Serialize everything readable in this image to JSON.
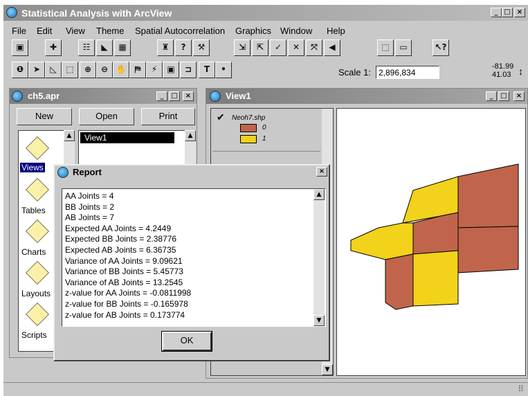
{
  "window": {
    "title": "Statistical Analysis with ArcView"
  },
  "menu": [
    "File",
    "Edit",
    "View",
    "Theme",
    "Spatial Autocorrelation",
    "Graphics",
    "Window",
    "Help"
  ],
  "toolbar1_icons": [
    "save-icon",
    "add-theme-icon",
    "theme-properties-icon",
    "edit-legend-icon",
    "open-table-icon",
    "find-icon",
    "locate-icon",
    "query-builder-icon",
    "zoom-full-icon",
    "zoom-active-icon",
    "zoom-selected-icon",
    "zoom-in-fixed-icon",
    "zoom-out-fixed-icon",
    "zoom-previous-icon",
    "select-graphics-icon",
    "clear-selected-icon",
    "help-icon"
  ],
  "toolbar2_icons": [
    "identify-icon",
    "pointer-icon",
    "vertex-edit-icon",
    "select-feature-icon",
    "zoom-in-icon",
    "zoom-out-icon",
    "pan-icon",
    "measure-icon",
    "hotlink-icon",
    "area-of-interest-icon",
    "label-icon",
    "text-icon",
    "draw-point-icon"
  ],
  "toolbar2_glyphs": [
    "❶",
    "➤",
    "◺",
    "⬚",
    "⊕",
    "⊖",
    "✋",
    "⛿",
    "⚡",
    "▣",
    "⊐",
    "T",
    "•"
  ],
  "scale": {
    "label": "Scale 1:",
    "value": "2,896,834"
  },
  "coords": {
    "x": "-81.99",
    "y": "41.03"
  },
  "project": {
    "title": "ch5.apr",
    "buttons": {
      "new": "New",
      "open": "Open",
      "print": "Print"
    },
    "icons": [
      {
        "label": "Views",
        "icon": "views-icon"
      },
      {
        "label": "Tables",
        "icon": "tables-icon"
      },
      {
        "label": "Charts",
        "icon": "charts-icon"
      },
      {
        "label": "Layouts",
        "icon": "layouts-icon"
      },
      {
        "label": "Scripts",
        "icon": "scripts-icon"
      }
    ],
    "list_selected": "View1"
  },
  "view": {
    "title": "View1",
    "theme": "Neoh7.shp",
    "legend": [
      {
        "label": "0",
        "color": "#c0654b"
      },
      {
        "label": "1",
        "color": "#f2d21a"
      }
    ]
  },
  "report": {
    "title": "Report",
    "lines": [
      "AA Joints = 4",
      "BB Joints = 2",
      "AB Joints = 7",
      "Expected AA Joints = 4.2449",
      "Expected BB Joints = 2.38776",
      "Expected AB Joints = 6.36735",
      "Variance of AA Joints = 9.09621",
      "Variance of BB Joints = 5.45773",
      "Variance of AB Joints = 13.2545",
      "z-value for AA Joints = -0.0811998",
      "z-value for BB Joints = -0.165978",
      "z-value for AB Joints = 0.173774"
    ],
    "ok": "OK"
  },
  "colors": {
    "value0": "#c0654b",
    "value1": "#f2d21a",
    "titlebar": "#8f8f8f"
  }
}
